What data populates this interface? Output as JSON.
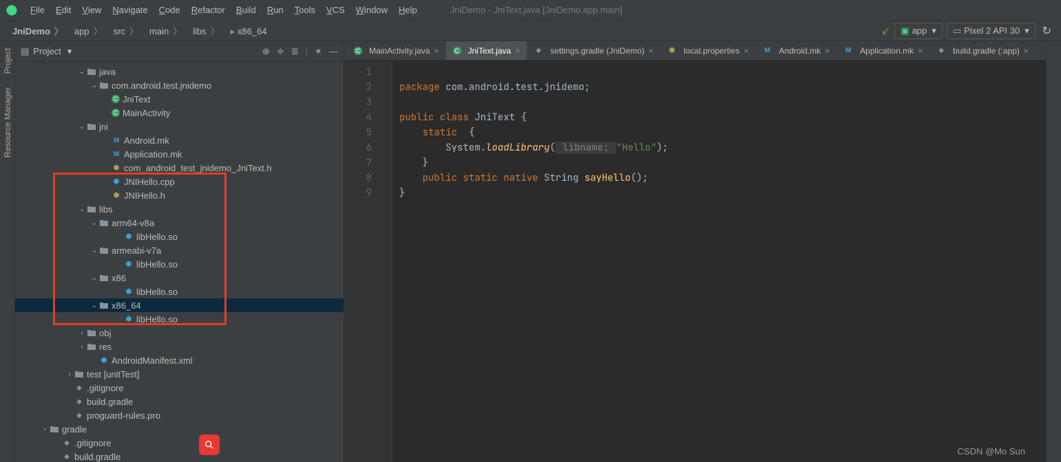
{
  "menubar": {
    "items": [
      "File",
      "Edit",
      "View",
      "Navigate",
      "Code",
      "Refactor",
      "Build",
      "Run",
      "Tools",
      "VCS",
      "Window",
      "Help"
    ],
    "title": "JniDemo - JniText.java [JniDemo.app.main]"
  },
  "breadcrumb": [
    "JniDemo",
    "app",
    "src",
    "main",
    "libs",
    "x86_64"
  ],
  "runconfig": {
    "app": "app",
    "device": "Pixel 2 API 30"
  },
  "panel": {
    "title": "Project"
  },
  "siderail": {
    "project": "Project",
    "res": "Resource Manager"
  },
  "tree": [
    {
      "depth": 5,
      "exp": "v",
      "ic": "folder",
      "label": "java"
    },
    {
      "depth": 6,
      "exp": "v",
      "ic": "folder",
      "label": "com.android.test.jnidemo"
    },
    {
      "depth": 7,
      "exp": "",
      "ic": "c",
      "label": "JniText"
    },
    {
      "depth": 7,
      "exp": "",
      "ic": "c",
      "label": "MainActivity"
    },
    {
      "depth": 5,
      "exp": "v",
      "ic": "folder",
      "label": "jni"
    },
    {
      "depth": 7,
      "exp": "",
      "ic": "m",
      "label": "Android.mk"
    },
    {
      "depth": 7,
      "exp": "",
      "ic": "m",
      "label": "Application.mk"
    },
    {
      "depth": 7,
      "exp": "",
      "ic": "h",
      "label": "com_android_test_jnidemo_JniText.h"
    },
    {
      "depth": 7,
      "exp": "",
      "ic": "so",
      "label": "JNIHello.cpp"
    },
    {
      "depth": 7,
      "exp": "",
      "ic": "h",
      "label": "JNIHello.h"
    },
    {
      "depth": 5,
      "exp": "v",
      "ic": "folder",
      "label": "libs"
    },
    {
      "depth": 6,
      "exp": "v",
      "ic": "folder",
      "label": "arm64-v8a"
    },
    {
      "depth": 8,
      "exp": "",
      "ic": "so",
      "label": "libHello.so"
    },
    {
      "depth": 6,
      "exp": "v",
      "ic": "folder",
      "label": "armeabi-v7a"
    },
    {
      "depth": 8,
      "exp": "",
      "ic": "so",
      "label": "libHello.so"
    },
    {
      "depth": 6,
      "exp": "v",
      "ic": "folder",
      "label": "x86"
    },
    {
      "depth": 8,
      "exp": "",
      "ic": "so",
      "label": "libHello.so"
    },
    {
      "depth": 6,
      "exp": "v",
      "ic": "folder",
      "label": "x86_64",
      "selected": true
    },
    {
      "depth": 8,
      "exp": "",
      "ic": "so",
      "label": "libHello.so"
    },
    {
      "depth": 5,
      "exp": ">",
      "ic": "folder",
      "label": "obj"
    },
    {
      "depth": 5,
      "exp": ">",
      "ic": "folder",
      "label": "res"
    },
    {
      "depth": 6,
      "exp": "",
      "ic": "so",
      "label": "AndroidManifest.xml"
    },
    {
      "depth": 4,
      "exp": ">",
      "ic": "folder",
      "label": "test [unitTest]"
    },
    {
      "depth": 4,
      "exp": "",
      "ic": "gradle",
      "label": ".gitignore"
    },
    {
      "depth": 4,
      "exp": "",
      "ic": "gradle",
      "label": "build.gradle"
    },
    {
      "depth": 4,
      "exp": "",
      "ic": "gradle",
      "label": "proguard-rules.pro"
    },
    {
      "depth": 2,
      "exp": ">",
      "ic": "folder",
      "label": "gradle"
    },
    {
      "depth": 3,
      "exp": "",
      "ic": "gradle",
      "label": ".gitignore"
    },
    {
      "depth": 3,
      "exp": "",
      "ic": "gradle",
      "label": "build.gradle"
    }
  ],
  "tabs": [
    {
      "label": "MainActivity.java",
      "ic": "c"
    },
    {
      "label": "JniText.java",
      "ic": "c",
      "active": true
    },
    {
      "label": "settings.gradle (JniDemo)",
      "ic": "gradle"
    },
    {
      "label": "local.properties",
      "ic": "h"
    },
    {
      "label": "Android.mk",
      "ic": "m"
    },
    {
      "label": "Application.mk",
      "ic": "m"
    },
    {
      "label": "build.gradle (:app)",
      "ic": "gradle"
    }
  ],
  "code": {
    "line1_kw": "package",
    "line1_rest": " com.android.test.jnidemo;",
    "line3_kw": "public class ",
    "line3_cls": "JniText",
    "line3_end": " {",
    "line4_kw": "    static",
    "line4_end": "  {",
    "line5_pre": "        System.",
    "line5_fn": "loadLibrary",
    "line5_open": "(",
    "line5_hint": " libname: ",
    "line5_str": "\"Hello\"",
    "line5_close": ");",
    "line6": "    }",
    "line7_kw": "    public static native ",
    "line7_type": "String ",
    "line7_fn": "sayHello",
    "line7_end": "();",
    "line8": "}"
  },
  "lines": [
    "1",
    "2",
    "3",
    "4",
    "5",
    "6",
    "7",
    "8",
    "9"
  ],
  "watermark": "CSDN @Mo Sun"
}
